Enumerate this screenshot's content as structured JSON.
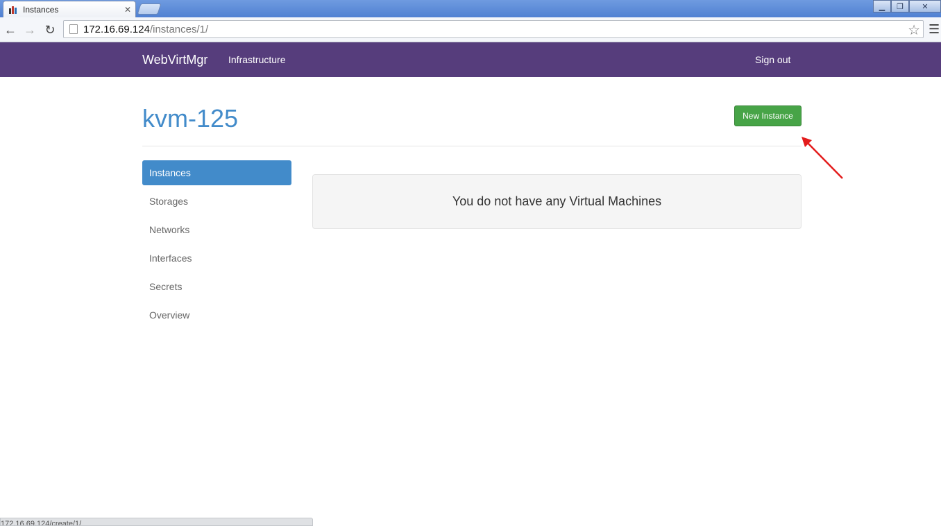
{
  "browser": {
    "tab_title": "Instances",
    "url_host": "172.16.69.124",
    "url_path": "/instances/1/",
    "status_url": "172.16.69.124/create/1/"
  },
  "navbar": {
    "brand": "WebVirtMgr",
    "infrastructure": "Infrastructure",
    "sign_out": "Sign out"
  },
  "page": {
    "title": "kvm-125",
    "new_instance_label": "New Instance",
    "empty_message": "You do not have any Virtual Machines"
  },
  "sidebar": {
    "items": [
      {
        "label": "Instances",
        "active": true
      },
      {
        "label": "Storages",
        "active": false
      },
      {
        "label": "Networks",
        "active": false
      },
      {
        "label": "Interfaces",
        "active": false
      },
      {
        "label": "Secrets",
        "active": false
      },
      {
        "label": "Overview",
        "active": false
      }
    ]
  },
  "colors": {
    "navbar": "#563d7c",
    "primary": "#428bca",
    "success": "#47a447",
    "annotation_arrow": "#e31b1b"
  }
}
